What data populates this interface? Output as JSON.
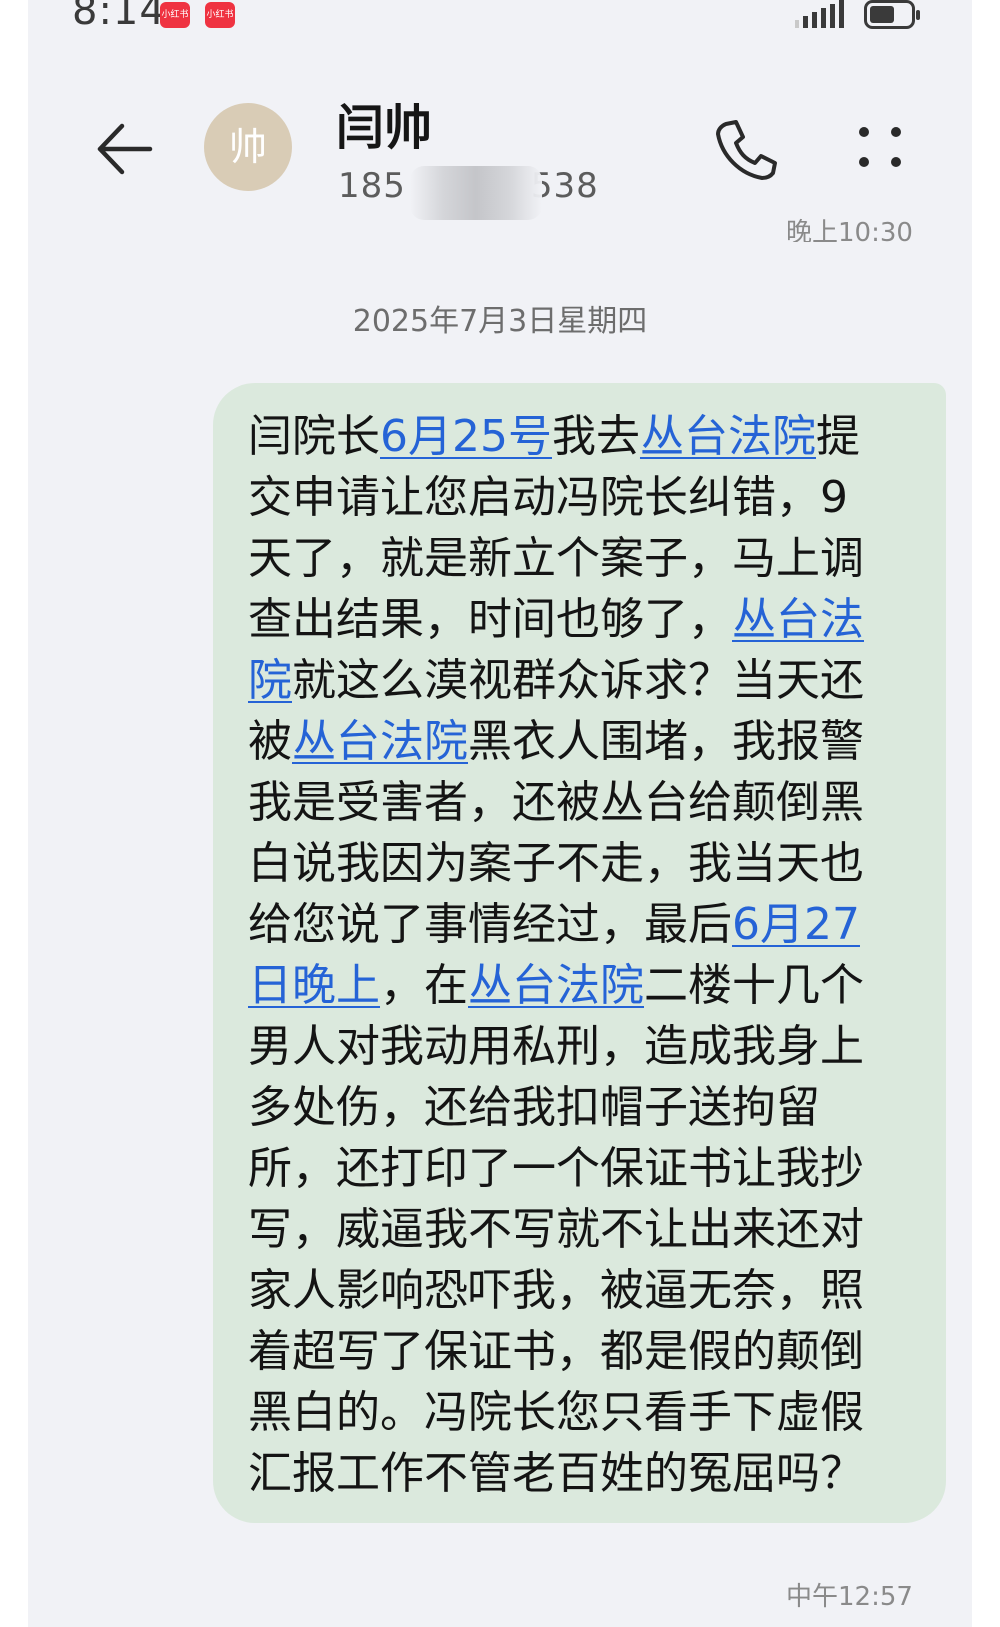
{
  "status_bar": {
    "time": "8:14",
    "badge_1": "小红书",
    "badge_2": "小红书"
  },
  "header": {
    "avatar_text": "帅",
    "contact_name": "闫帅",
    "contact_number": "185      538",
    "back_icon": "arrow-left-icon",
    "call_icon": "phone-icon",
    "more_icon": "more-dots-icon"
  },
  "thread": {
    "prev_time": "晚上10:30",
    "date_separator": "2025年7月3日星期四",
    "message_lines": [
      [
        {
          "t": "闫院长"
        },
        {
          "t": "6月25号",
          "link": true
        },
        {
          "t": "我去"
        },
        {
          "t": "丛台法院",
          "link": true
        },
        {
          "t": "提"
        }
      ],
      [
        {
          "t": "交申请让您启动冯院长纠错，9"
        }
      ],
      [
        {
          "t": "天了，就是新立个案子，马上调"
        }
      ],
      [
        {
          "t": "查出结果，时间也够了，"
        },
        {
          "t": "丛台法",
          "link": true
        }
      ],
      [
        {
          "t": "院",
          "link": true
        },
        {
          "t": "就这么漠视群众诉求？当天还"
        }
      ],
      [
        {
          "t": "被"
        },
        {
          "t": "丛台法院",
          "link": true
        },
        {
          "t": "黑衣人围堵，我报警"
        }
      ],
      [
        {
          "t": "我是受害者，还被丛台给颠倒黑"
        }
      ],
      [
        {
          "t": "白说我因为案子不走，我当天也"
        }
      ],
      [
        {
          "t": "给您说了事情经过，最后"
        },
        {
          "t": "6月27",
          "link": true
        }
      ],
      [
        {
          "t": "日晚上",
          "link": true
        },
        {
          "t": "，在"
        },
        {
          "t": "丛台法院",
          "link": true
        },
        {
          "t": "二楼十几个"
        }
      ],
      [
        {
          "t": "男人对我动用私刑，造成我身上"
        }
      ],
      [
        {
          "t": "多处伤，还给我扣帽子送拘留"
        }
      ],
      [
        {
          "t": "所，还打印了一个保证书让我抄"
        }
      ],
      [
        {
          "t": "写，威逼我不写就不让出来还对"
        }
      ],
      [
        {
          "t": "家人影响恐吓我，被逼无奈，照"
        }
      ],
      [
        {
          "t": "着超写了保证书，都是假的颠倒"
        }
      ],
      [
        {
          "t": "黑白的。冯院长您只看手下虚假"
        }
      ],
      [
        {
          "t": "汇报工作不管老百姓的冤屈吗？"
        }
      ]
    ],
    "sent_time": "中午12:57"
  },
  "colors": {
    "background": "#f1f2f6",
    "bubble": "#dbe9dd",
    "link": "#2563d6",
    "avatar": "#d9ccb6"
  }
}
